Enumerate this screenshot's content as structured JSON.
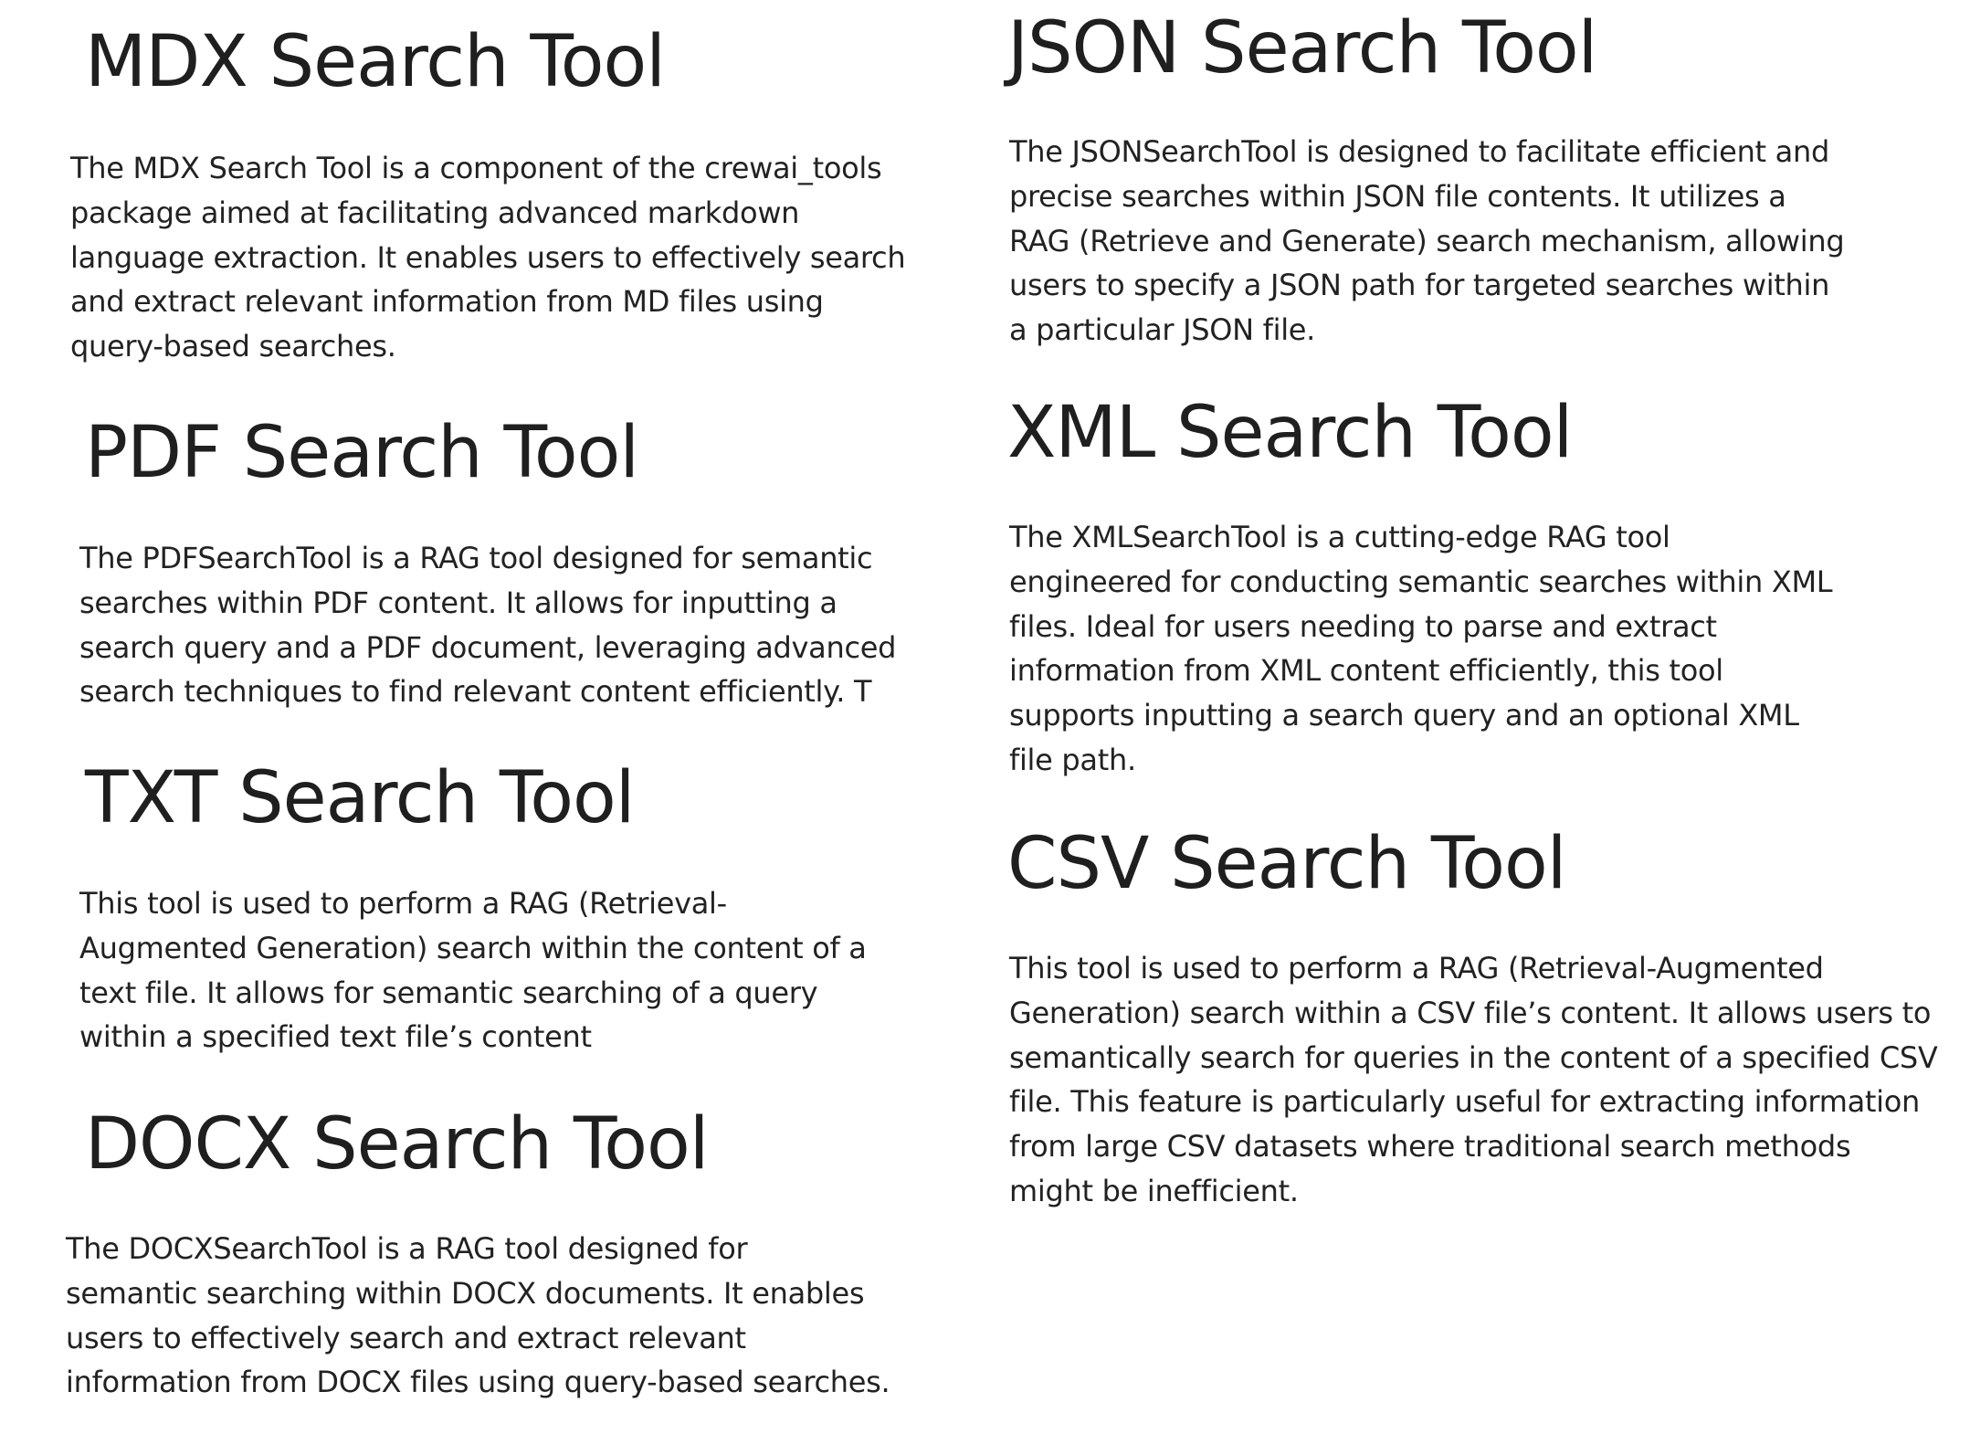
{
  "sections": {
    "mdx": {
      "heading": "MDX Search Tool",
      "lines": [
        "The MDX Search Tool is a component of the crewai_tools",
        "package aimed at facilitating advanced markdown",
        "language extraction. It enables users to effectively search",
        "and extract relevant information from MD files using",
        "query-based searches."
      ]
    },
    "pdf": {
      "heading": "PDF Search Tool",
      "lines": [
        "The PDFSearchTool is a RAG tool designed for semantic",
        "searches within PDF content. It allows for inputting a",
        "search query and a PDF document, leveraging advanced",
        "search techniques to find relevant content efficiently. T"
      ]
    },
    "txt": {
      "heading": "TXT Search Tool",
      "lines": [
        "This tool is used to perform a RAG (Retrieval-",
        "Augmented Generation) search within the content of a",
        "text file. It allows for semantic searching of a query",
        "within a specified text file’s content"
      ]
    },
    "docx": {
      "heading": "DOCX Search Tool",
      "lines": [
        "The DOCXSearchTool is a RAG tool designed for",
        "semantic searching within DOCX documents. It enables",
        "users to effectively search and extract relevant",
        "information from DOCX files using query-based searches."
      ]
    },
    "json": {
      "heading": "JSON Search Tool",
      "lines": [
        "The JSONSearchTool is designed to facilitate efficient and",
        "precise searches within JSON file contents. It utilizes a",
        "RAG (Retrieve and Generate) search mechanism, allowing",
        "users to specify a JSON path for targeted searches within",
        "a particular JSON file."
      ]
    },
    "xml": {
      "heading": "XML Search Tool",
      "lines": [
        "The XMLSearchTool is a cutting-edge RAG tool",
        "engineered for conducting semantic searches within XML",
        "files. Ideal for users needing to parse and extract",
        "information from XML content efficiently, this tool",
        "supports inputting a search query and an optional XML",
        "file path."
      ]
    },
    "csv": {
      "heading": "CSV Search Tool",
      "lines": [
        "This tool is used to perform a RAG (Retrieval-Augmented",
        "Generation) search within a CSV file’s content. It allows users to",
        "semantically search for queries in the content of a specified CSV",
        "file. This feature is particularly useful for extracting information",
        "from large CSV datasets where traditional search methods",
        "might be inefficient."
      ]
    }
  }
}
